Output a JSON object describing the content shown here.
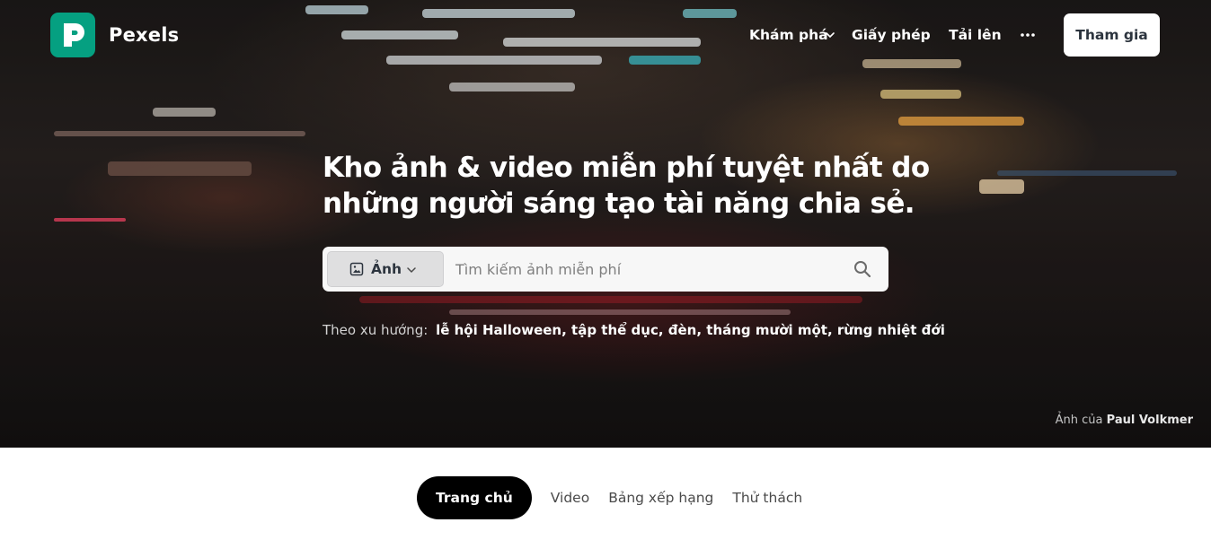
{
  "header": {
    "brand": "Pexels",
    "nav": {
      "explore": "Khám phá",
      "license": "Giấy phép",
      "upload": "Tải lên"
    },
    "join_label": "Tham gia"
  },
  "hero": {
    "headline_line1": "Kho ảnh & video miễn phí tuyệt nhất do",
    "headline_line2": "những người sáng tạo tài năng chia sẻ.",
    "search": {
      "type_label": "Ảnh",
      "placeholder": "Tìm kiếm ảnh miễn phí"
    },
    "trending": {
      "label": "Theo xu hướng:",
      "items": [
        "lễ hội Halloween",
        "tập thể dục",
        "đèn",
        "tháng mười một",
        "rừng nhiệt đới"
      ]
    },
    "credit": {
      "prefix": "Ảnh của",
      "author": "Paul Volkmer"
    }
  },
  "tabs": [
    {
      "label": "Trang chủ",
      "active": true
    },
    {
      "label": "Video",
      "active": false
    },
    {
      "label": "Bảng xếp hạng",
      "active": false
    },
    {
      "label": "Thử thách",
      "active": false
    }
  ],
  "colors": {
    "brand": "#05a081",
    "tab_active_bg": "#000000",
    "search_bg": "#f7f7f7"
  }
}
